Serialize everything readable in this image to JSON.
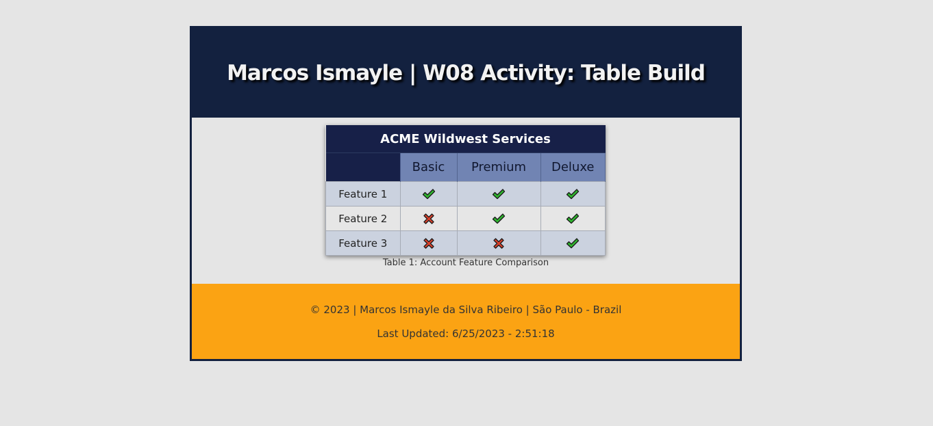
{
  "header": {
    "title": "Marcos Ismayle | W08 Activity: Table Build"
  },
  "table": {
    "heading": "ACME Wildwest Services",
    "corner": "",
    "columns": [
      "Basic",
      "Premium",
      "Deluxe"
    ],
    "rows": [
      {
        "feature": "Feature 1",
        "values": [
          "check-icon",
          "check-icon",
          "check-icon"
        ]
      },
      {
        "feature": "Feature 2",
        "values": [
          "x-icon",
          "check-icon",
          "check-icon"
        ]
      },
      {
        "feature": "Feature 3",
        "values": [
          "x-icon",
          "x-icon",
          "check-icon"
        ]
      }
    ],
    "caption": "Table 1: Account Feature Comparison"
  },
  "footer": {
    "copyright": "© 2023 | Marcos Ismayle da Silva Ribeiro | São Paulo - Brazil",
    "last_updated": "Last Updated: 6/25/2023 - 2:51:18"
  },
  "colors": {
    "header_bg": "#13213f",
    "table_head_bg": "#172048",
    "plan_head_bg": "#7184b3",
    "row_odd_bg": "#cbd2df",
    "row_even_bg": "#e6e6e6",
    "footer_bg": "#fba313",
    "check_green": "#2fb52f",
    "x_red": "#d9412b"
  }
}
